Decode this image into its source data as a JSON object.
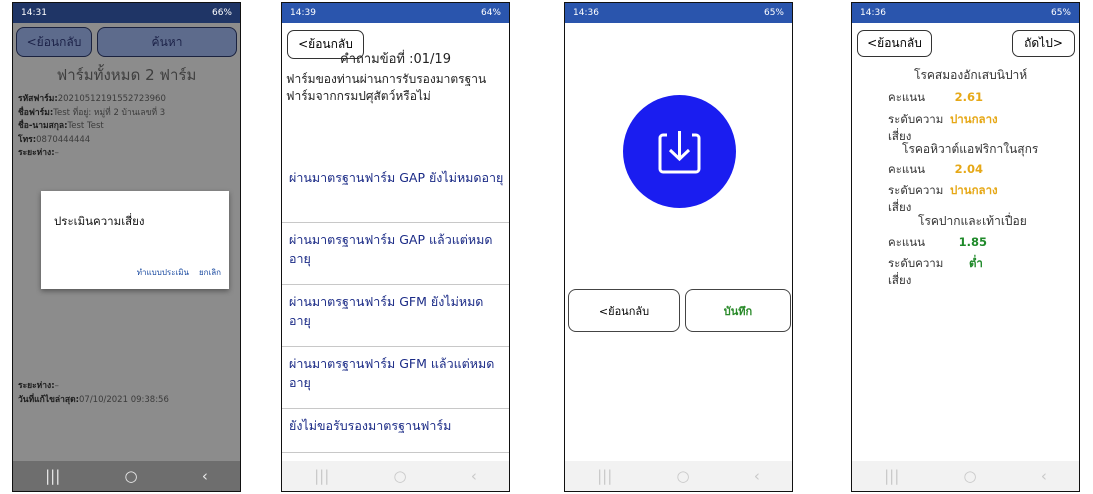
{
  "screen1": {
    "status_time": "14:31",
    "status_right": "66%",
    "back_label": "<ย้อนกลับ",
    "search_label": "ค้นหา",
    "title": "ฟาร์มทั้งหมด 2 ฟาร์ม",
    "fields": [
      {
        "label": "รหัสฟาร์ม:",
        "value": "20210512191552723960"
      },
      {
        "label": "ชื่อฟาร์ม:",
        "value": "Test  ที่อยู่: หมู่ที่ 2 บ้านเลขที่ 3"
      },
      {
        "label": "ชื่อ-นามสกุล:",
        "value": "Test Test"
      },
      {
        "label": "โทร:",
        "value": "0870444444"
      },
      {
        "label": "ระยะห่าง:",
        "value": "–"
      }
    ],
    "fields_bottom": [
      {
        "label": "ระยะห่าง:",
        "value": "–"
      },
      {
        "label": "วันที่แก้ไขล่าสุด:",
        "value": "07/10/2021 09:38:56"
      }
    ],
    "dialog": {
      "title": "ประเมินความเสี่ยง",
      "action_primary": "ทำแบบประเมิน",
      "action_cancel": "ยกเลิก"
    }
  },
  "screen2": {
    "status_time": "14:39",
    "status_right": "64%",
    "back_label": "<ย้อนกลับ",
    "question_header": "คำถามข้อที่ :01/19",
    "question_text": "ฟาร์มของท่านผ่านการรับรองมาตรฐานฟาร์มจากกรมปศุสัตว์หรือไม่",
    "choices": [
      "ผ่านมาตรฐานฟาร์ม GAP ยังไม่หมดอายุ",
      "ผ่านมาตรฐานฟาร์ม GAP แล้วแต่หมดอายุ",
      "ผ่านมาตรฐานฟาร์ม GFM ยังไม่หมดอายุ",
      "ผ่านมาตรฐานฟาร์ม GFM แล้วแต่หมดอายุ",
      "ยังไม่ขอรับรองมาตรฐานฟาร์ม"
    ]
  },
  "screen3": {
    "status_time": "14:36",
    "status_right": "65%",
    "back_label": "<ย้อนกลับ",
    "save_label": "บันทึก"
  },
  "screen4": {
    "status_time": "14:36",
    "status_right": "65%",
    "back_label": "<ย้อนกลับ",
    "next_label": "ถัดไป>",
    "score_label": "คะแนน",
    "level_label_1": "ระดับความ",
    "level_label_2": "เสี่ยง",
    "results": [
      {
        "disease": "โรคสมองอักเสบนิปาห์",
        "score": "2.61",
        "level": "ปานกลาง",
        "color": "#e6a817"
      },
      {
        "disease": "โรคอหิวาต์แอฟริกาในสุกร",
        "score": "2.04",
        "level": "ปานกลาง",
        "color": "#e6a817"
      },
      {
        "disease": "โรคปากและเท้าเปื่อย",
        "score": "1.85",
        "level": "ต่ำ",
        "color": "#1f8a2a"
      }
    ]
  }
}
